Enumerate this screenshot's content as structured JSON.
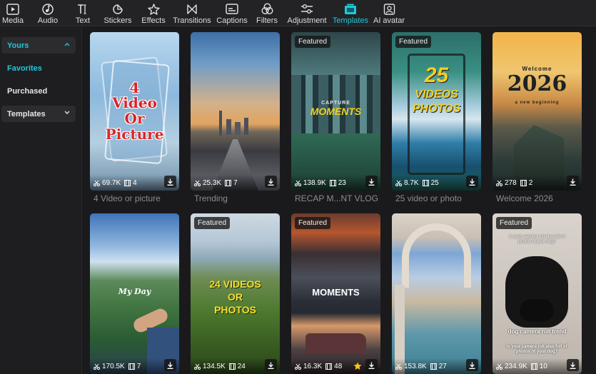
{
  "toolbar": {
    "items": [
      {
        "label": "Media",
        "icon": "media-icon"
      },
      {
        "label": "Audio",
        "icon": "audio-icon"
      },
      {
        "label": "Text",
        "icon": "text-icon"
      },
      {
        "label": "Stickers",
        "icon": "stickers-icon"
      },
      {
        "label": "Effects",
        "icon": "effects-icon"
      },
      {
        "label": "Transitions",
        "icon": "transitions-icon"
      },
      {
        "label": "Captions",
        "icon": "captions-icon"
      },
      {
        "label": "Filters",
        "icon": "filters-icon"
      },
      {
        "label": "Adjustment",
        "icon": "adjustment-icon"
      },
      {
        "label": "Templates",
        "icon": "templates-icon"
      },
      {
        "label": "AI avatar",
        "icon": "ai-avatar-icon"
      }
    ],
    "active": "Templates",
    "accent_color": "#1fc8d8"
  },
  "sidebar": {
    "yours": "Yours",
    "favorites": "Favorites",
    "purchased": "Purchased",
    "templates": "Templates"
  },
  "cards": [
    {
      "title": "4 Video or picture",
      "uses": "69.7K",
      "clips": "4",
      "featured": false,
      "overlay": [
        "4",
        "Video",
        "Or",
        "Picture"
      ]
    },
    {
      "title": "Trending",
      "uses": "25.3K",
      "clips": "7",
      "featured": false
    },
    {
      "title": "RECAP M...NT VLOG",
      "uses": "138.9K",
      "clips": "23",
      "featured": true,
      "overlay": [
        "CAPTURE",
        "MOMENTS"
      ]
    },
    {
      "title": "25 video or photo",
      "uses": "8.7K",
      "clips": "25",
      "featured": true,
      "overlay": [
        "25",
        "VIDEOS",
        "PHOTOS"
      ]
    },
    {
      "title": "Welcome 2026",
      "uses": "278",
      "clips": "2",
      "featured": false,
      "overlay": [
        "Welcome",
        "2026",
        "a new beginning"
      ]
    },
    {
      "title": "",
      "uses": "170.5K",
      "clips": "7",
      "featured": false,
      "overlay": [
        "My Day"
      ]
    },
    {
      "title": "",
      "uses": "134.5K",
      "clips": "24",
      "featured": true,
      "overlay": [
        "24 VIDEOS",
        "OR",
        "PHOTOS"
      ]
    },
    {
      "title": "",
      "uses": "16.3K",
      "clips": "48",
      "featured": true,
      "overlay": [
        "MOMENTS"
      ]
    },
    {
      "title": "",
      "uses": "153.8K",
      "clips": "27",
      "featured": false
    },
    {
      "title": "",
      "uses": "234.9K",
      "clips": "10",
      "featured": true,
      "overlay": [
        "Is your camera roll also full of photos of your dog?",
        "dog camera roll trend",
        "is your camera roll also full of photos of your dog?"
      ]
    }
  ],
  "featured_label": "Featured"
}
